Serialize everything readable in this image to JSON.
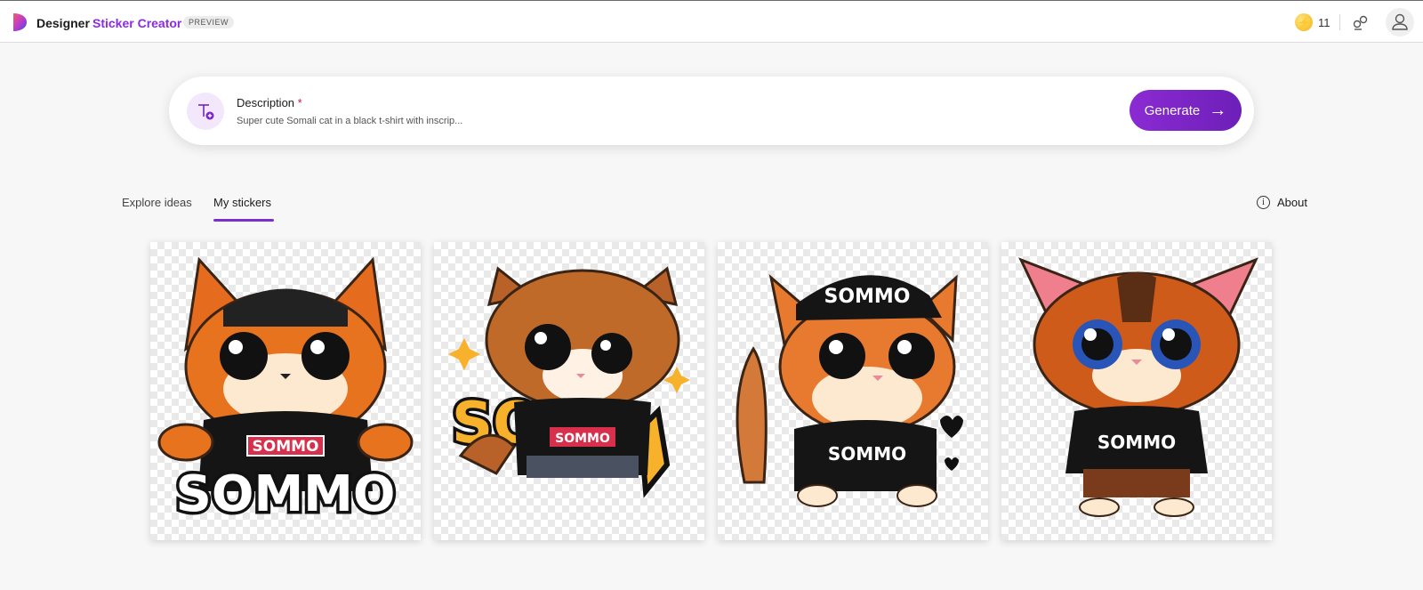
{
  "header": {
    "brand": "Designer",
    "app_name": "Sticker Creator",
    "badge": "PREVIEW",
    "coins": "11",
    "coin_symbol": "⚡"
  },
  "prompt": {
    "label": "Description",
    "required_mark": "*",
    "value": "Super cute Somali cat in a black t-shirt with inscrip...",
    "generate_label": "Generate",
    "generate_arrow": "→"
  },
  "tabs": [
    {
      "label": "Explore ideas"
    },
    {
      "label": "My stickers"
    }
  ],
  "about": {
    "label": "About",
    "icon_glyph": "i"
  },
  "stickers": [
    {
      "shirt_text": "SOMMO",
      "big_text": "SOMMO"
    },
    {
      "shirt_text": "SOMMO",
      "big_text": "SO"
    },
    {
      "shirt_text": "SOMMO",
      "cap_text": "SOMMO"
    },
    {
      "shirt_text": "SOMMO"
    }
  ],
  "colors": {
    "accent": "#8a2be2",
    "generate": "#7b24c8"
  }
}
